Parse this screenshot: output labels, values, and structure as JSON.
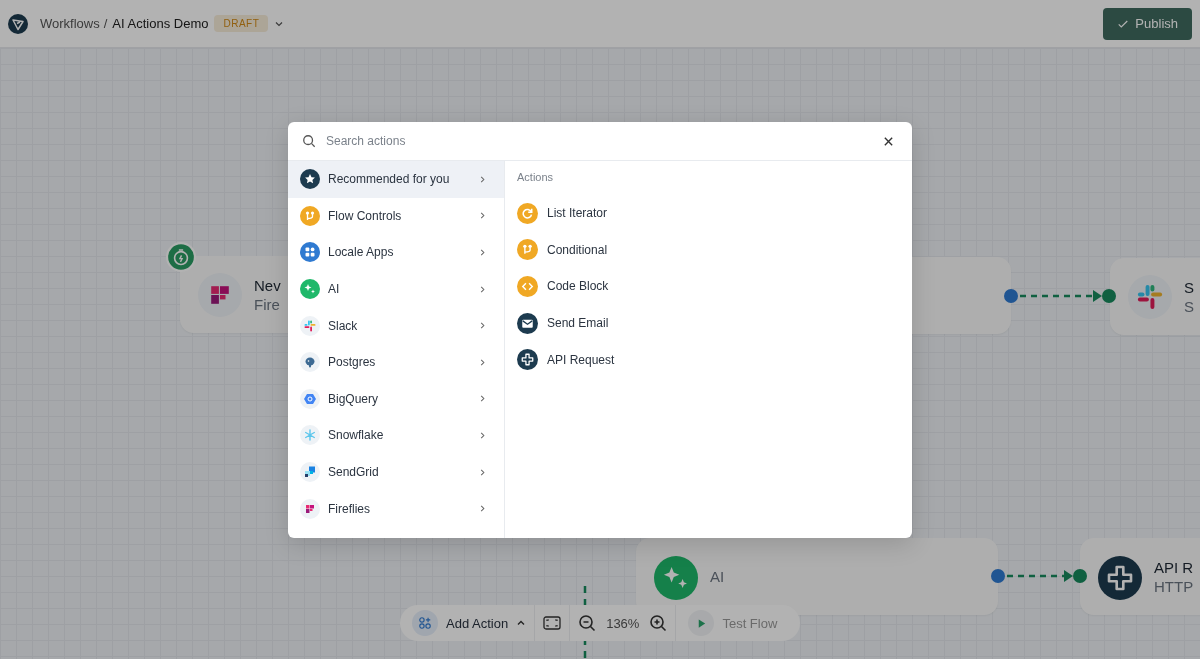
{
  "header": {
    "breadcrumb": "Workflows",
    "separator": "/",
    "title": "AI Actions Demo",
    "badge": "DRAFT",
    "publish": "Publish"
  },
  "nodes": [
    {
      "title": "Nev",
      "subtitle": "Fire",
      "kind": "fireflies"
    },
    {
      "title": "S",
      "subtitle": "S",
      "kind": "slack"
    },
    {
      "subtitle": "AI",
      "kind": "ai"
    },
    {
      "title": "API R",
      "subtitle": "HTTP",
      "kind": "api"
    }
  ],
  "toolbar": {
    "add_action": "Add Action",
    "zoom": "136%",
    "test_flow": "Test Flow"
  },
  "modal": {
    "search": {
      "placeholder": "Search actions"
    },
    "categories": [
      {
        "label": "Recommended for you",
        "kind": "star",
        "selected": true
      },
      {
        "label": "Flow Controls",
        "kind": "flow",
        "selected": false
      },
      {
        "label": "Locale Apps",
        "kind": "apps",
        "selected": false
      },
      {
        "label": "AI",
        "kind": "ai",
        "selected": false
      },
      {
        "label": "Slack",
        "kind": "slack",
        "selected": false
      },
      {
        "label": "Postgres",
        "kind": "postgres",
        "selected": false
      },
      {
        "label": "BigQuery",
        "kind": "bigquery",
        "selected": false
      },
      {
        "label": "Snowflake",
        "kind": "snowflake",
        "selected": false
      },
      {
        "label": "SendGrid",
        "kind": "sendgrid",
        "selected": false
      },
      {
        "label": "Fireflies",
        "kind": "fireflies",
        "selected": false
      }
    ],
    "section_title": "Actions",
    "actions": [
      {
        "label": "List Iterator",
        "kind": "iterator"
      },
      {
        "label": "Conditional",
        "kind": "conditional"
      },
      {
        "label": "Code Block",
        "kind": "code"
      },
      {
        "label": "Send Email",
        "kind": "email"
      },
      {
        "label": "API Request",
        "kind": "api"
      }
    ]
  }
}
